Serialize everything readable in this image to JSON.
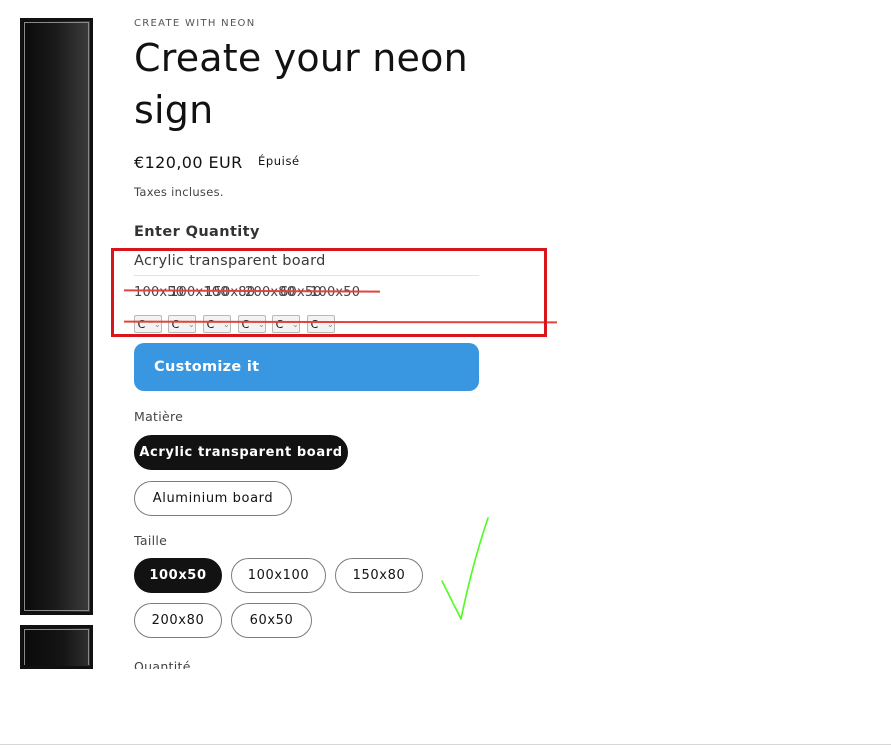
{
  "product": {
    "eyebrow": "CREATE WITH NEON",
    "title": "Create your neon sign",
    "price": "€120,00 EUR",
    "stock_badge": "Épuisé",
    "tax_note": "Taxes incluses."
  },
  "quantity_widget": {
    "heading": "Enter Quantity",
    "row_name": "Acrylic transparent board",
    "size_labels": [
      "100x50",
      "100x100",
      "150x80",
      "200x80",
      "60x50"
    ],
    "stepper_values": [
      "C",
      "C",
      "C",
      "C",
      "C",
      "C"
    ]
  },
  "customize_button": "Customize it",
  "variant_options": {
    "material_label": "Matière",
    "materials": [
      "Acrylic transparent board",
      "Aluminium board"
    ],
    "selected_material": "Acrylic transparent board",
    "size_label": "Taille",
    "sizes": [
      "100x50",
      "100x100",
      "150x80",
      "200x80",
      "60x50"
    ],
    "selected_size": "100x50",
    "quantity_label": "Quantité"
  },
  "colors": {
    "accent_button": "#3897e0",
    "annotation_box": "#d9141a",
    "annotation_strike": "#e0443c",
    "annotation_check": "#4cff1a",
    "selected_pill": "#121212"
  }
}
